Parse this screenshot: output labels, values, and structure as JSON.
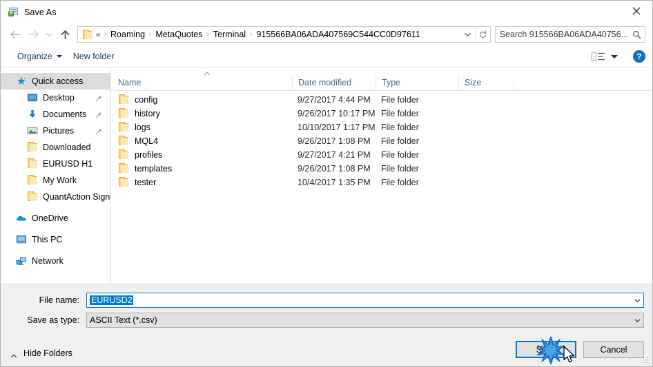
{
  "window": {
    "title": "Save As",
    "icon": "save-as-icon",
    "close_label": "✕"
  },
  "navbar": {
    "back_icon": "back-arrow-icon",
    "forward_icon": "forward-arrow-icon",
    "recent_icon": "chevron-down-icon",
    "up_icon": "up-arrow-icon",
    "folder_icon": "folder-icon",
    "breadcrumb_prefix": "«",
    "breadcrumbs": [
      "Roaming",
      "MetaQuotes",
      "Terminal",
      "915566BA06ADA407569C544CC0D97611"
    ],
    "separator": "›",
    "dropdown_icon": "chevron-down-icon",
    "refresh_icon": "refresh-icon",
    "search_text": "Search 915566BA06ADA40756...",
    "search_icon": "search-icon"
  },
  "commandbar": {
    "organize_label": "Organize",
    "new_folder_label": "New folder",
    "view_icon": "view-mode-icon",
    "help_label": "?",
    "help_icon": "help-icon"
  },
  "sidebar": {
    "items": [
      {
        "label": "Quick access",
        "icon": "quick-access-star-icon",
        "level": 0,
        "selected": true,
        "pinned": false
      },
      {
        "label": "Desktop",
        "icon": "desktop-icon",
        "level": 1,
        "selected": false,
        "pinned": true
      },
      {
        "label": "Documents",
        "icon": "documents-download-icon",
        "level": 1,
        "selected": false,
        "pinned": true
      },
      {
        "label": "Pictures",
        "icon": "pictures-icon",
        "level": 1,
        "selected": false,
        "pinned": true
      },
      {
        "label": "Downloaded",
        "icon": "folder-icon",
        "level": 1,
        "selected": false,
        "pinned": false
      },
      {
        "label": "EURUSD H1",
        "icon": "folder-icon",
        "level": 1,
        "selected": false,
        "pinned": false
      },
      {
        "label": "My Work",
        "icon": "folder-icon",
        "level": 1,
        "selected": false,
        "pinned": false
      },
      {
        "label": "QuantAction Signal",
        "icon": "folder-icon",
        "level": 1,
        "selected": false,
        "pinned": false
      },
      {
        "label": "OneDrive",
        "icon": "onedrive-cloud-icon",
        "level": 0,
        "selected": false,
        "pinned": false,
        "gap": true
      },
      {
        "label": "This PC",
        "icon": "this-pc-icon",
        "level": 0,
        "selected": false,
        "pinned": false,
        "gap": true
      },
      {
        "label": "Network",
        "icon": "network-icon",
        "level": 0,
        "selected": false,
        "pinned": false,
        "gap": true
      }
    ]
  },
  "filelist": {
    "sort_indicator": "sort-ascending-icon",
    "columns": [
      "Name",
      "Date modified",
      "Type",
      "Size"
    ],
    "rows": [
      {
        "name": "config",
        "date": "9/27/2017 4:44 PM",
        "type": "File folder",
        "size": "",
        "icon": "folder-icon"
      },
      {
        "name": "history",
        "date": "9/26/2017 10:17 PM",
        "type": "File folder",
        "size": "",
        "icon": "folder-icon"
      },
      {
        "name": "logs",
        "date": "10/10/2017 1:17 PM",
        "type": "File folder",
        "size": "",
        "icon": "folder-icon"
      },
      {
        "name": "MQL4",
        "date": "9/26/2017 1:08 PM",
        "type": "File folder",
        "size": "",
        "icon": "folder-icon"
      },
      {
        "name": "profiles",
        "date": "9/27/2017 4:21 PM",
        "type": "File folder",
        "size": "",
        "icon": "folder-icon"
      },
      {
        "name": "templates",
        "date": "9/26/2017 1:08 PM",
        "type": "File folder",
        "size": "",
        "icon": "folder-icon"
      },
      {
        "name": "tester",
        "date": "10/4/2017 1:35 PM",
        "type": "File folder",
        "size": "",
        "icon": "folder-icon"
      }
    ]
  },
  "footer": {
    "filename_label": "File name:",
    "filename_value": "EURUSD2",
    "filetype_label": "Save as type:",
    "filetype_value": "ASCII Text (*.csv)",
    "save_label": "Save",
    "cancel_label": "Cancel",
    "hide_folders_label": "Hide Folders",
    "hide_folders_icon": "chevron-up-icon",
    "resize_grip_icon": "resize-grip-icon"
  },
  "overlay": {
    "cursor_icon": "mouse-cursor-icon",
    "click_icon": "click-burst-icon"
  },
  "colors": {
    "accent": "#0078d7",
    "folder": "#fcd77f",
    "header_text": "#4a6b8a",
    "command_text": "#1b3a5c",
    "selection": "#dcdcdc",
    "footer_bg": "#f0f0f0"
  }
}
